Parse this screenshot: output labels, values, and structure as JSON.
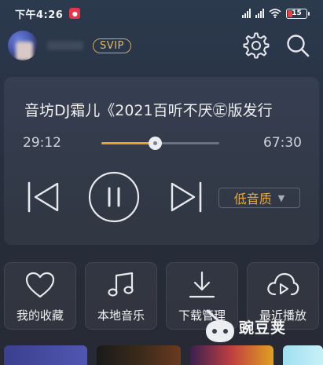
{
  "status_bar": {
    "time": "下午4:26",
    "battery": "15"
  },
  "header": {
    "badge": "SVIP",
    "icons": [
      "settings-icon",
      "search-icon"
    ]
  },
  "player": {
    "song_title": "音坊DJ霜儿《2021百听不厌㊣版发行",
    "current_time": "29:12",
    "total_time": "67:30",
    "progress": 0.45,
    "quality": "低音质"
  },
  "shortcuts": [
    {
      "label": "我的收藏",
      "icon": "heart-icon"
    },
    {
      "label": "本地音乐",
      "icon": "music-note-icon"
    },
    {
      "label": "下载管理",
      "icon": "download-icon"
    },
    {
      "label": "最近播放",
      "icon": "cloud-play-icon"
    }
  ],
  "watermark": "豌豆荚",
  "colors": {
    "accent": "#f0a020",
    "svip": "#e4bb62",
    "quality": "#e8a93a"
  }
}
